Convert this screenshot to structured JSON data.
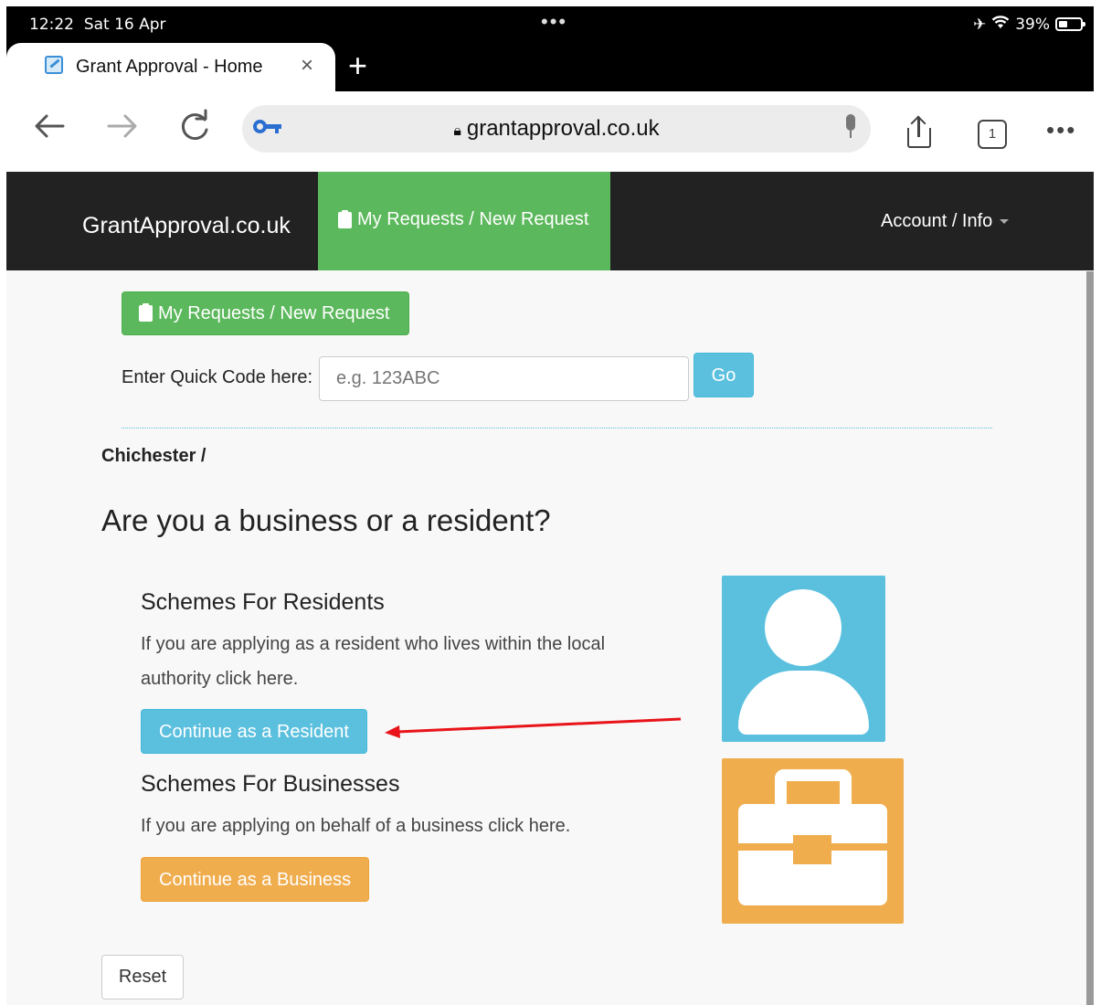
{
  "status_bar": {
    "time": "12:22",
    "date": "Sat 16 Apr",
    "dots": "•••",
    "battery": "39%"
  },
  "browser": {
    "tab_title": "Grant Approval - Home",
    "tab_close": "×",
    "new_tab": "+",
    "url": "grantapproval.co.uk",
    "tab_count": "1",
    "more": "•••"
  },
  "site_nav": {
    "brand": "GrantApproval.co.uk",
    "active_item": "My Requests / New Request",
    "account": "Account / Info"
  },
  "main": {
    "requests_button": "My Requests / New Request",
    "quick_code_label": "Enter Quick Code here:",
    "quick_code_placeholder": "e.g. 123ABC",
    "go_button": "Go",
    "breadcrumb": "Chichester /",
    "heading": "Are you a business or a resident?",
    "residents": {
      "title": "Schemes For Residents",
      "text": "If you are applying as a resident who lives within the local authority click here.",
      "button": "Continue as a Resident"
    },
    "businesses": {
      "title": "Schemes For Businesses",
      "text": "If you are applying on behalf of a business click here.",
      "button": "Continue as a Business"
    },
    "reset_button": "Reset"
  },
  "colors": {
    "success": "#5cb85c",
    "info": "#5bc0de",
    "warning": "#f0ad4e",
    "navbar": "#222222",
    "annotation": "#e8141a"
  }
}
